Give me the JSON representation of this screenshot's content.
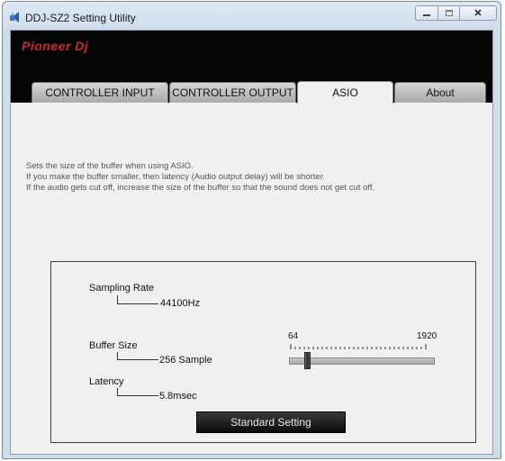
{
  "window": {
    "title": "DDJ-SZ2 Setting Utility",
    "app_icon": "audio-device-icon",
    "controls": [
      "minimize-icon",
      "maximize-icon",
      "close-icon"
    ]
  },
  "brand": {
    "logo_text": "Pioneer Dj",
    "logo_color": "#c8282d"
  },
  "tabs": [
    {
      "label": "CONTROLLER INPUT",
      "active": false
    },
    {
      "label": "CONTROLLER OUTPUT",
      "active": false
    },
    {
      "label": "ASIO",
      "active": true
    },
    {
      "label": "About",
      "active": false
    }
  ],
  "asio": {
    "description": [
      "Sets the size of the buffer when using ASIO.",
      "If you make the buffer smaller, then latency (Audio output delay) will be shorter.",
      "If the audio gets cut off, increase the size of the buffer so that the sound does not get cut off."
    ],
    "sampling_rate": {
      "label": "Sampling Rate",
      "value": "44100Hz"
    },
    "buffer_size": {
      "label": "Buffer Size",
      "value": "256 Sample",
      "slider_min_label": "64",
      "slider_max_label": "1920",
      "slider_min": 64,
      "slider_max": 1920,
      "slider_value": 256
    },
    "latency": {
      "label": "Latency",
      "value": "5.8msec"
    },
    "standard_button_label": "Standard Setting"
  }
}
